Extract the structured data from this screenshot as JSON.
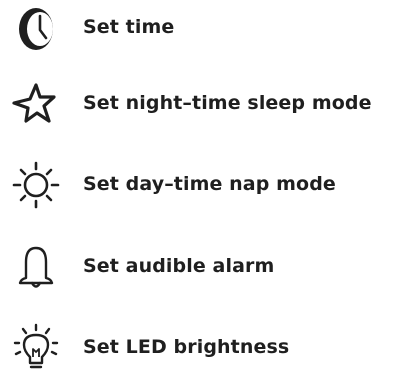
{
  "menu": {
    "items": [
      {
        "label": "Set time",
        "icon": "clock-icon"
      },
      {
        "label": "Set night–time sleep mode",
        "icon": "star-icon"
      },
      {
        "label": "Set day–time nap mode",
        "icon": "sun-icon"
      },
      {
        "label": "Set audible alarm",
        "icon": "bell-icon"
      },
      {
        "label": "Set LED brightness",
        "icon": "light-bulb-icon"
      }
    ]
  },
  "colors": {
    "text": "#1f1f1f",
    "icon": "#1f1f1f",
    "background": "#ffffff"
  }
}
